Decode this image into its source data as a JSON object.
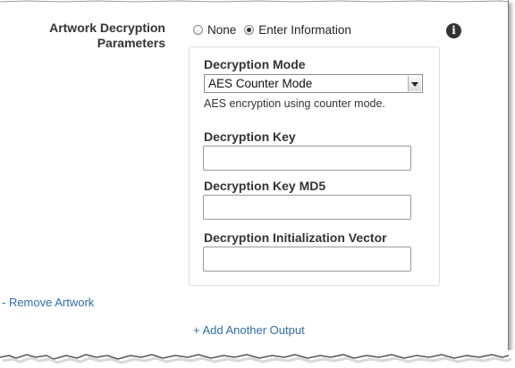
{
  "section": {
    "label_line1": "Artwork Decryption",
    "label_line2": "Parameters"
  },
  "options": {
    "none_label": "None",
    "enter_label": "Enter Information",
    "selected": "Enter Information"
  },
  "info_icon": "info-icon",
  "decryption_mode": {
    "label": "Decryption Mode",
    "value": "AES Counter Mode",
    "help": "AES encryption using counter mode."
  },
  "decryption_key": {
    "label": "Decryption Key",
    "value": ""
  },
  "decryption_key_md5": {
    "label": "Decryption Key MD5",
    "value": ""
  },
  "init_vector": {
    "label": "Decryption Initialization Vector",
    "value": ""
  },
  "links": {
    "remove_artwork": "- Remove Artwork",
    "add_output": "+ Add Another Output"
  },
  "colors": {
    "link": "#2a6db5",
    "label": "#333333"
  }
}
